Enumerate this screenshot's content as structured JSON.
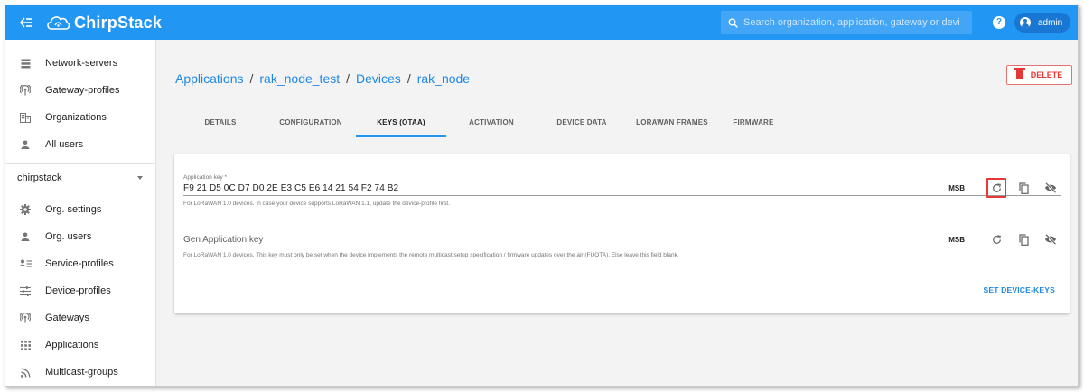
{
  "app": {
    "name": "ChirpStack"
  },
  "search": {
    "placeholder": "Search organization, application, gateway or device"
  },
  "user": {
    "name": "admin"
  },
  "help_label": "?",
  "sidebar": {
    "top_items": [
      {
        "label": "Network-servers",
        "icon": "server-icon"
      },
      {
        "label": "Gateway-profiles",
        "icon": "gateway-profile-icon"
      },
      {
        "label": "Organizations",
        "icon": "organization-icon"
      },
      {
        "label": "All users",
        "icon": "user-icon"
      }
    ],
    "org_selector": {
      "selected": "chirpstack"
    },
    "org_items": [
      {
        "label": "Org. settings",
        "icon": "gear-icon"
      },
      {
        "label": "Org. users",
        "icon": "user-icon"
      },
      {
        "label": "Service-profiles",
        "icon": "service-profile-icon"
      },
      {
        "label": "Device-profiles",
        "icon": "tune-icon"
      },
      {
        "label": "Gateways",
        "icon": "gateway-icon"
      },
      {
        "label": "Applications",
        "icon": "apps-icon"
      },
      {
        "label": "Multicast-groups",
        "icon": "rss-icon"
      }
    ]
  },
  "breadcrumb": {
    "items": [
      "Applications",
      "rak_node_test",
      "Devices",
      "rak_node"
    ],
    "separator": "/"
  },
  "delete_button": {
    "label": "DELETE"
  },
  "tabs": [
    {
      "label": "DETAILS"
    },
    {
      "label": "CONFIGURATION"
    },
    {
      "label": "KEYS (OTAA)"
    },
    {
      "label": "ACTIVATION"
    },
    {
      "label": "DEVICE DATA"
    },
    {
      "label": "LORAWAN FRAMES"
    },
    {
      "label": "FIRMWARE"
    }
  ],
  "active_tab": "KEYS (OTAA)",
  "form": {
    "app_key": {
      "label": "Application key *",
      "value": "F9 21 D5 0C D7 D0 2E E3 C5 E6 14 21 54 F2 74 B2",
      "byte_order": "MSB",
      "helper": "For LoRaWAN 1.0 devices. In case your device supports LoRaWAN 1.1, update the device-profile first."
    },
    "gen_app_key": {
      "placeholder": "Gen Application key",
      "byte_order": "MSB",
      "helper": "For LoRaWAN 1.0 devices. This key must only be set when the device implements the remote multicast setup specification / firmware updates over the air (FUOTA). Else leave this field blank."
    },
    "submit_label": "SET DEVICE-KEYS"
  },
  "colors": {
    "primary": "#2196f3",
    "link": "#1e88e5",
    "danger": "#e53935",
    "highlight_box": "#e53935"
  }
}
